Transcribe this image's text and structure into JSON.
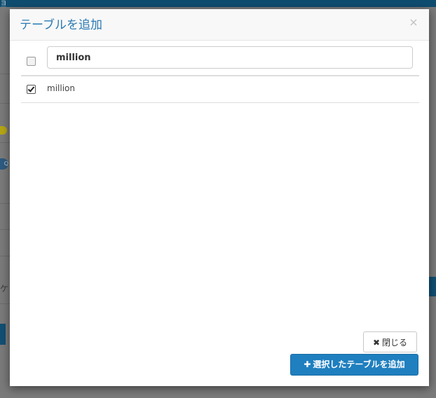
{
  "background": {
    "topbar_text": "ョフ",
    "search_glyph": "Q",
    "left_text": "ケ"
  },
  "modal": {
    "title": "テーブルを追加",
    "close_glyph": "×",
    "filter": {
      "value": "million",
      "placeholder": ""
    },
    "rows": [
      {
        "label": "million",
        "checked": true
      }
    ],
    "buttons": {
      "close_label": "閉じる",
      "close_icon": "✖",
      "add_label": "選択したテーブルを追加",
      "add_icon": "✚"
    }
  },
  "colors": {
    "title": "#2a7ab3",
    "primary_button": "#1f7fbf"
  }
}
